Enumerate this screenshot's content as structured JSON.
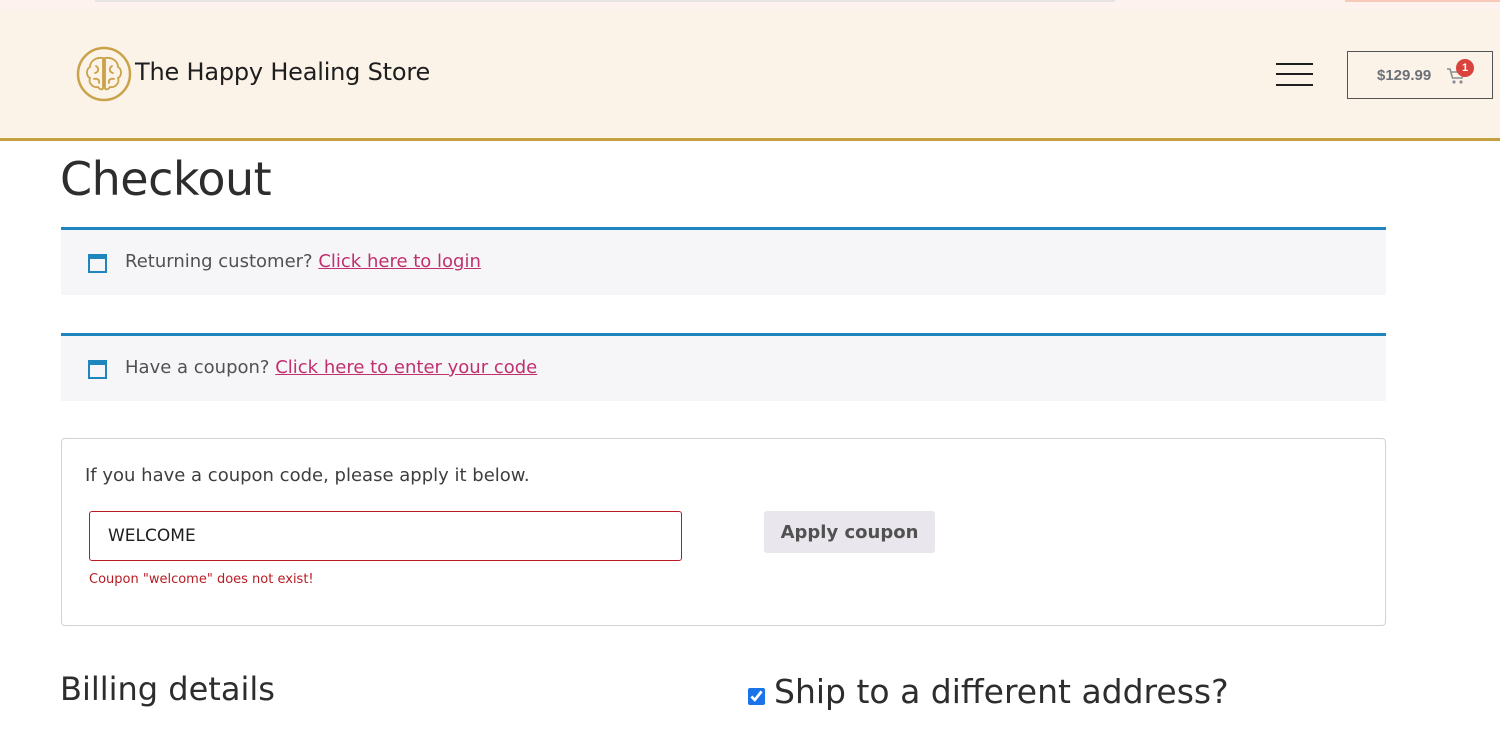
{
  "header": {
    "brand": "The Happy Healing Store",
    "cart": {
      "total": "$129.99",
      "count": "1"
    },
    "icons": {
      "logo": "brain-logo-icon",
      "menu": "hamburger-menu-icon",
      "cart": "shopping-cart-icon"
    }
  },
  "page": {
    "title": "Checkout"
  },
  "notices": {
    "login": {
      "text": "Returning customer?",
      "link": "Click here to login",
      "icon": "window-icon"
    },
    "coupon": {
      "text": "Have a coupon?",
      "link": "Click here to enter your code",
      "icon": "window-icon"
    }
  },
  "coupon_form": {
    "hint": "If you have a coupon code, please apply it below.",
    "value": "WELCOME",
    "error": "Coupon \"welcome\" does not exist!",
    "apply_label": "Apply coupon"
  },
  "sections": {
    "billing_title": "Billing details",
    "ship_label": "Ship to a different address?",
    "ship_checked": true
  },
  "colors": {
    "header_bg": "#fcf3e8",
    "header_border": "#c4a040",
    "notice_border": "#1e85be",
    "link": "#c0306f",
    "error": "#b81c23",
    "badge": "#d9433b"
  }
}
